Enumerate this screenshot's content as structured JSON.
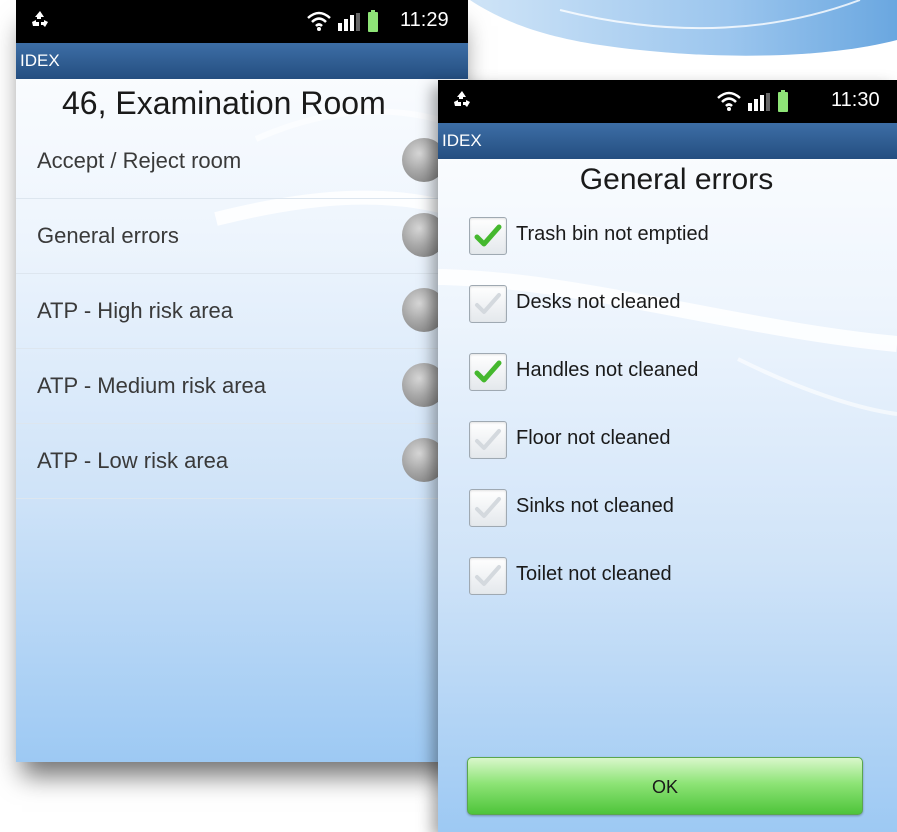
{
  "colors": {
    "statusbar": "#000000",
    "titlebar": "#2f5c91",
    "ok_button": "#63cc4c",
    "check_green": "#45b82e"
  },
  "left_screen": {
    "status": {
      "time": "11:29",
      "icons": [
        "recycle-icon",
        "wifi-icon",
        "signal-icon",
        "battery-icon"
      ]
    },
    "app_title": "IDEX",
    "room_title": "46, Examination Room",
    "items": [
      {
        "label": "Accept / Reject room"
      },
      {
        "label": "General errors"
      },
      {
        "label": "ATP - High risk area"
      },
      {
        "label": "ATP - Medium risk area"
      },
      {
        "label": "ATP - Low risk area"
      }
    ]
  },
  "right_screen": {
    "status": {
      "time": "11:30",
      "icons": [
        "recycle-icon",
        "wifi-icon",
        "signal-icon",
        "battery-icon"
      ]
    },
    "app_title": "IDEX",
    "dialog_title": "General errors",
    "checks": [
      {
        "label": "Trash bin not emptied",
        "checked": true
      },
      {
        "label": "Desks not cleaned",
        "checked": false
      },
      {
        "label": "Handles not cleaned",
        "checked": true
      },
      {
        "label": "Floor not cleaned",
        "checked": false
      },
      {
        "label": "Sinks not cleaned",
        "checked": false
      },
      {
        "label": "Toilet not cleaned",
        "checked": false
      }
    ],
    "ok_label": "OK"
  }
}
